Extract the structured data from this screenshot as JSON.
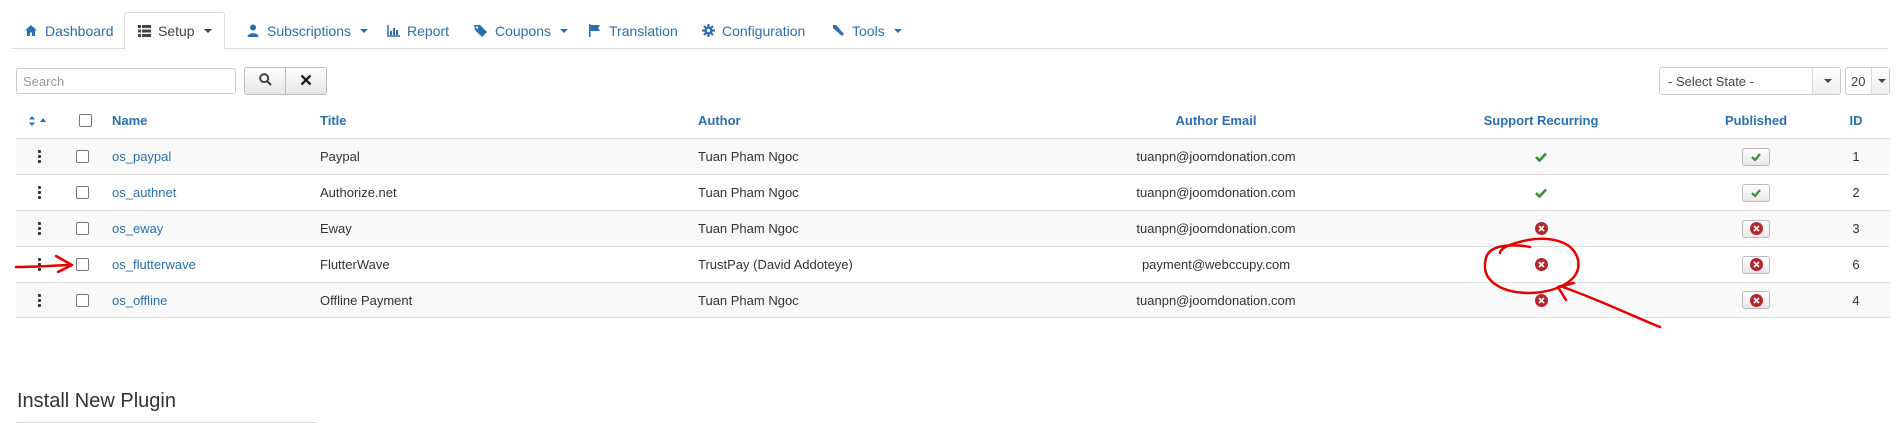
{
  "nav": {
    "items": [
      {
        "label": "Dashboard",
        "icon": "home-icon",
        "dropdown": false,
        "active": false
      },
      {
        "label": "Setup",
        "icon": "list-icon",
        "dropdown": true,
        "active": true
      },
      {
        "label": "Subscriptions",
        "icon": "user-icon",
        "dropdown": true,
        "active": false
      },
      {
        "label": "Report",
        "icon": "bar-chart-icon",
        "dropdown": false,
        "active": false
      },
      {
        "label": "Coupons",
        "icon": "tag-icon",
        "dropdown": true,
        "active": false
      },
      {
        "label": "Translation",
        "icon": "flag-icon",
        "dropdown": false,
        "active": false
      },
      {
        "label": "Configuration",
        "icon": "gear-icon",
        "dropdown": false,
        "active": false
      },
      {
        "label": "Tools",
        "icon": "wrench-icon",
        "dropdown": true,
        "active": false
      }
    ]
  },
  "search": {
    "placeholder": "Search",
    "value": ""
  },
  "filters": {
    "state": "- Select State -",
    "limit": "20"
  },
  "table": {
    "headers": {
      "name": "Name",
      "title": "Title",
      "author": "Author",
      "author_email": "Author Email",
      "support_recurring": "Support Recurring",
      "published": "Published",
      "id": "ID"
    },
    "rows": [
      {
        "name": "os_paypal",
        "title": "Paypal",
        "author": "Tuan Pham Ngoc",
        "email": "tuanpn@joomdonation.com",
        "recurring": true,
        "published": true,
        "id": "1"
      },
      {
        "name": "os_authnet",
        "title": "Authorize.net",
        "author": "Tuan Pham Ngoc",
        "email": "tuanpn@joomdonation.com",
        "recurring": true,
        "published": true,
        "id": "2"
      },
      {
        "name": "os_eway",
        "title": "Eway",
        "author": "Tuan Pham Ngoc",
        "email": "tuanpn@joomdonation.com",
        "recurring": false,
        "published": false,
        "id": "3"
      },
      {
        "name": "os_flutterwave",
        "title": "FlutterWave",
        "author": "TrustPay (David Addoteye)",
        "email": "payment@webccupy.com",
        "recurring": false,
        "published": false,
        "id": "6"
      },
      {
        "name": "os_offline",
        "title": "Offline Payment",
        "author": "Tuan Pham Ngoc",
        "email": "tuanpn@joomdonation.com",
        "recurring": false,
        "published": false,
        "id": "4"
      }
    ]
  },
  "install": {
    "title": "Install New Plugin"
  },
  "colors": {
    "link": "#2a6fb0",
    "check": "#3c8c3c",
    "cross": "#b3262d",
    "annotation": "#e60000"
  }
}
